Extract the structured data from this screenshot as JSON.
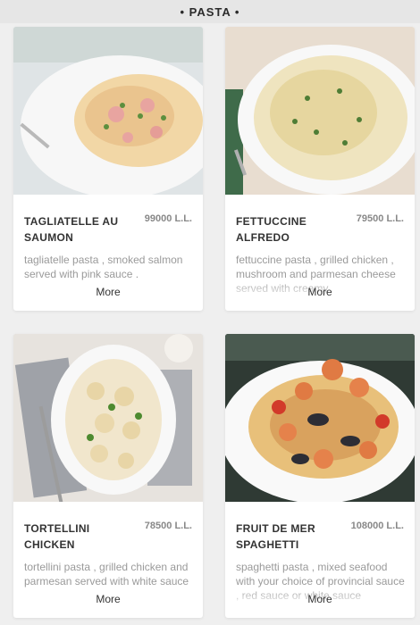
{
  "header": {
    "title": "• PASTA •"
  },
  "items": [
    {
      "name": "TAGLIATELLE AU SAUMON",
      "price": "99000 L.L.",
      "description": "tagliatelle pasta , smoked salmon served with pink sauce .",
      "more_label": "More"
    },
    {
      "name": "FETTUCCINE ALFREDO",
      "price": "79500 L.L.",
      "description": "fettuccine pasta , grilled chicken , mushroom and parmesan cheese served with creamy",
      "more_label": "More"
    },
    {
      "name": "TORTELLINI CHICKEN",
      "price": "78500 L.L.",
      "description": "tortellini pasta , grilled chicken and parmesan served with white sauce",
      "more_label": "More"
    },
    {
      "name": "FRUIT DE MER SPAGHETTI",
      "price": "108000 L.L.",
      "description": "spaghetti pasta , mixed seafood with your choice  of provincial sauce , red sauce or white sauce",
      "more_label": "More"
    }
  ]
}
